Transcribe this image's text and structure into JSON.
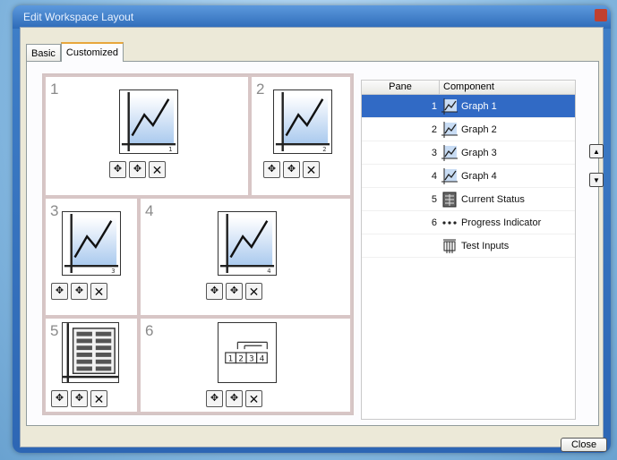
{
  "window": {
    "title": "Edit Workspace Layout"
  },
  "tabs": [
    {
      "label": "Basic"
    },
    {
      "label": "Customized"
    }
  ],
  "panes": [
    {
      "number": "1",
      "kind": "graph",
      "corner_label": "1"
    },
    {
      "number": "2",
      "kind": "graph",
      "corner_label": "2"
    },
    {
      "number": "3",
      "kind": "graph",
      "corner_label": "3"
    },
    {
      "number": "4",
      "kind": "graph",
      "corner_label": "4"
    },
    {
      "number": "5",
      "kind": "status",
      "corner_label": ""
    },
    {
      "number": "6",
      "kind": "progress",
      "corner_label": ""
    }
  ],
  "progress_icon": {
    "digits": [
      "1",
      "2",
      "3",
      "4"
    ]
  },
  "pane_buttons": {
    "up_icon": "up-arrow-icon",
    "down_icon": "down-arrow-icon",
    "remove_label": "✕"
  },
  "component_table": {
    "headers": {
      "pane": "Pane",
      "component": "Component"
    },
    "rows": [
      {
        "pane": "1",
        "icon": "graph-icon",
        "component": "Graph 1",
        "selected": true
      },
      {
        "pane": "2",
        "icon": "graph-icon",
        "component": "Graph 2",
        "selected": false
      },
      {
        "pane": "3",
        "icon": "graph-icon",
        "component": "Graph 3",
        "selected": false
      },
      {
        "pane": "4",
        "icon": "graph-icon",
        "component": "Graph 4",
        "selected": false
      },
      {
        "pane": "5",
        "icon": "status-grid-icon",
        "component": "Current Status",
        "selected": false
      },
      {
        "pane": "6",
        "icon": "progress-dots-icon",
        "component": "Progress Indicator",
        "selected": false
      },
      {
        "pane": "",
        "icon": "test-inputs-icon",
        "component": "Test Inputs",
        "selected": false
      }
    ]
  },
  "side_buttons": {
    "up_icon": "move-up-icon",
    "down_icon": "move-down-icon"
  },
  "close_button": {
    "label": "Close"
  },
  "colors": {
    "selection": "#316ac5",
    "tab_accent": "#e8a73c",
    "window_frame": "#3f7fc8"
  }
}
